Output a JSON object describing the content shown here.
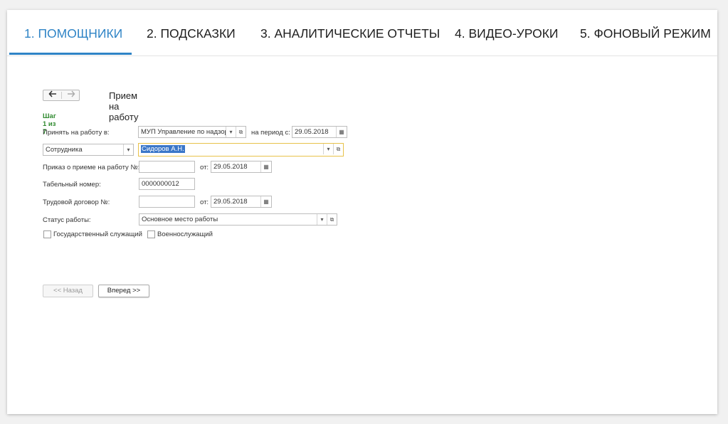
{
  "tabs": [
    {
      "label": "1. ПОМОЩНИКИ",
      "active": true
    },
    {
      "label": "2. ПОДСКАЗКИ",
      "active": false
    },
    {
      "label": "3. АНАЛИТИЧЕСКИЕ ОТЧЕТЫ",
      "active": false
    },
    {
      "label": "4. ВИДЕО-УРОКИ",
      "active": false
    },
    {
      "label": "5. ФОНОВЫЙ РЕЖИМ",
      "active": false
    }
  ],
  "form": {
    "title": "Прием на работу",
    "step": "Шаг 1 из 7",
    "hire_to_label": "Принять на работу в:",
    "organization": "МУП Управление по надзор",
    "period_label": "на период с:",
    "period_date": "29.05.2018",
    "employee_type": "Сотрудника",
    "employee_name": "Сидоров А.Н.",
    "order_label": "Приказ о приеме на работу №:",
    "order_number": "",
    "order_from_label": "от:",
    "order_date": "29.05.2018",
    "tab_number_label": "Табельный номер:",
    "tab_number": "0000000012",
    "contract_label": "Трудовой договор №:",
    "contract_number": "",
    "contract_from_label": "от:",
    "contract_date": "29.05.2018",
    "status_label": "Статус работы:",
    "status_value": "Основное место работы",
    "civil_servant_label": "Государственный служащий",
    "civil_servant_checked": false,
    "military_label": "Военнослужащий",
    "military_checked": false
  },
  "buttons": {
    "back": "<< Назад",
    "next": "Вперед >>"
  },
  "icons": {
    "nav_back": "arrow-left-icon",
    "nav_forward": "arrow-right-icon",
    "calendar": "calendar-icon",
    "dropdown": "chevron-down-icon",
    "open": "open-link-icon"
  },
  "colors": {
    "accent": "#2f84c6",
    "step": "#2f8a2f",
    "focus_border": "#e8c24a",
    "selection": "#3b77c9"
  }
}
